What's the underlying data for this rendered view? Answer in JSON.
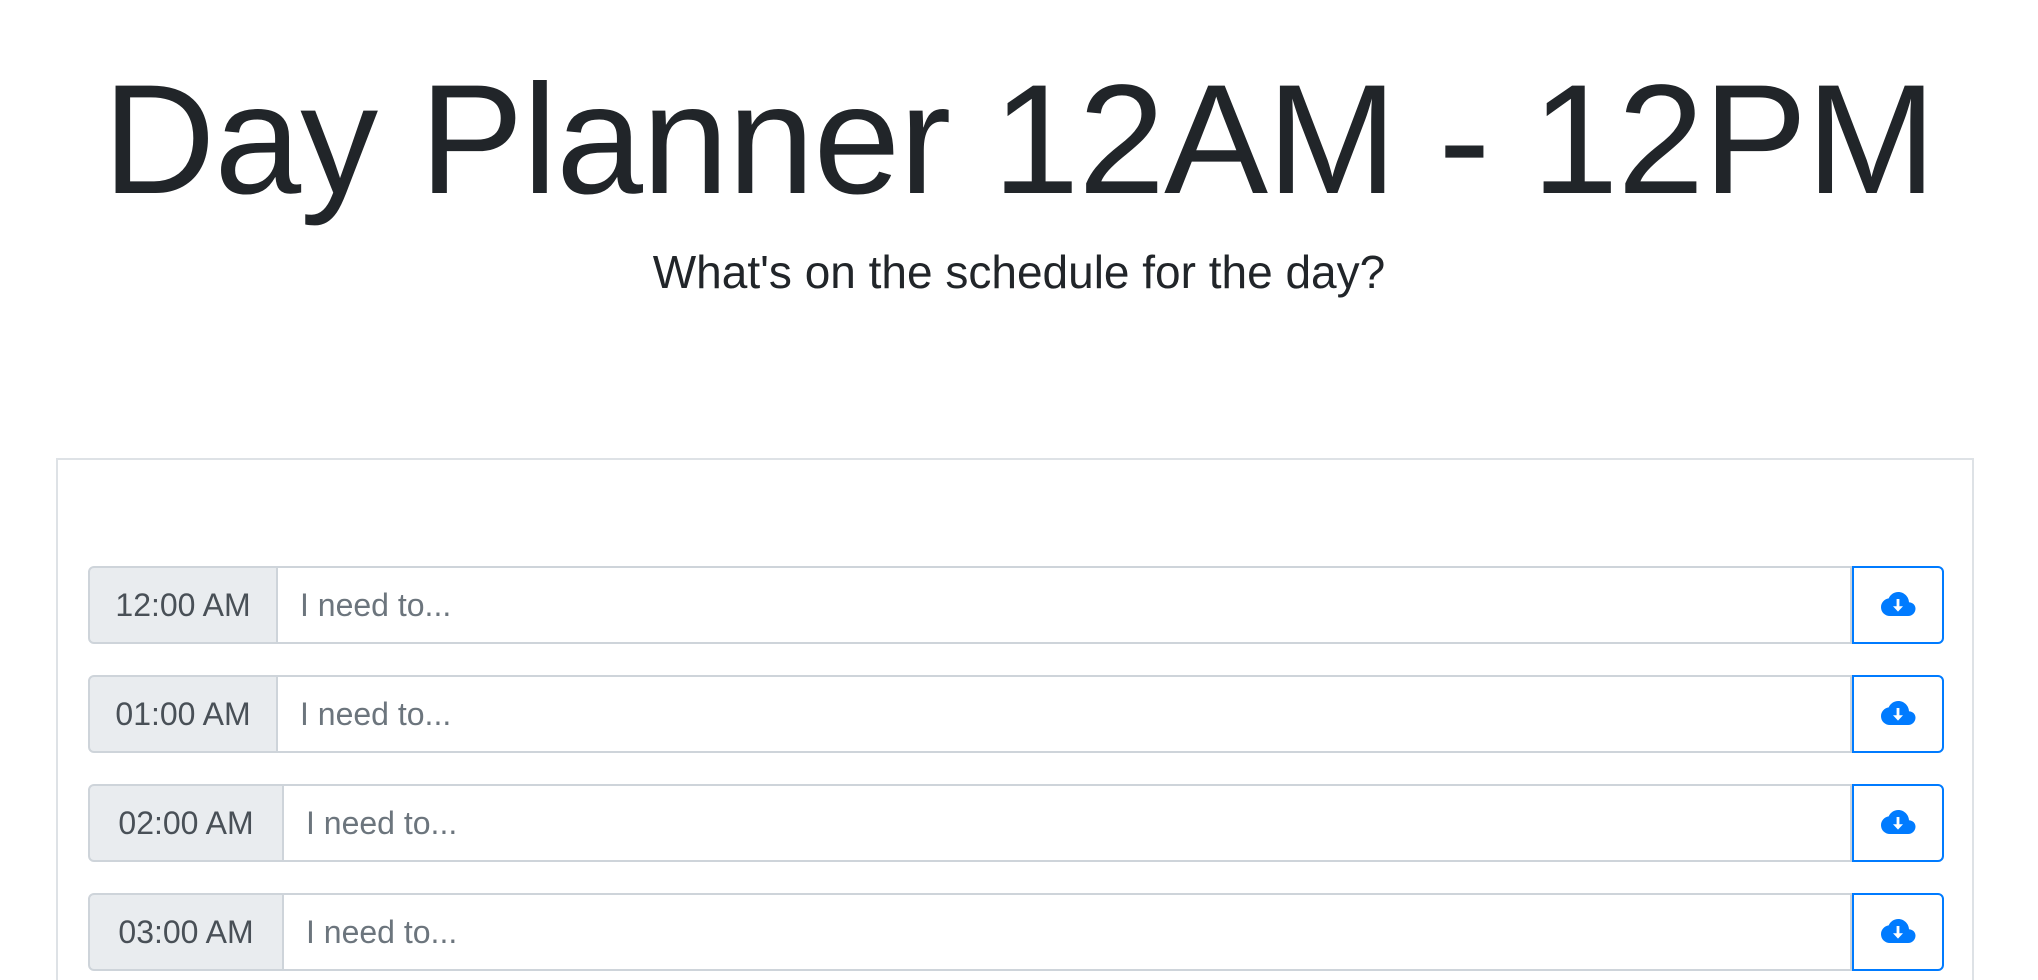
{
  "header": {
    "title": "Day Planner 12AM - 12PM",
    "subtitle": "What's on the schedule for the day?"
  },
  "planner": {
    "rows": [
      {
        "time": "12:00 AM",
        "placeholder": "I need to...",
        "value": ""
      },
      {
        "time": "01:00 AM",
        "placeholder": "I need to...",
        "value": ""
      },
      {
        "time": "02:00 AM",
        "placeholder": "I need to...",
        "value": ""
      },
      {
        "time": "03:00 AM",
        "placeholder": "I need to...",
        "value": ""
      }
    ],
    "save_icon": "cloud-download-icon"
  },
  "colors": {
    "accent": "#007bff",
    "time_bg": "#e9ecef",
    "border": "#ced4da",
    "text": "#212529"
  }
}
